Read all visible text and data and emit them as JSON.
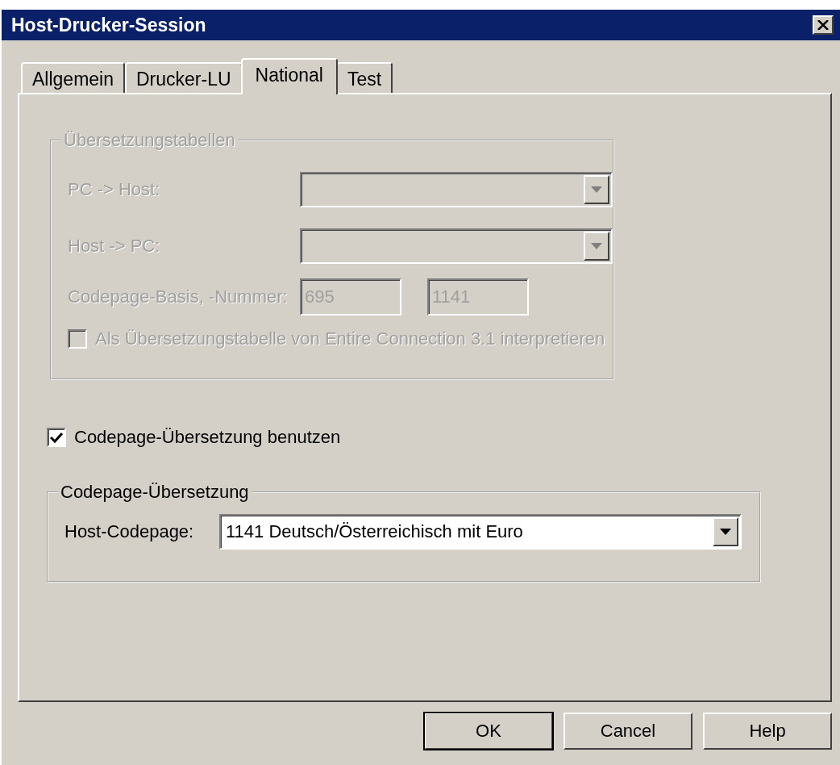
{
  "window": {
    "title": "Host-Drucker-Session"
  },
  "tabs": [
    {
      "label": "Allgemein",
      "selected": false
    },
    {
      "label": "Drucker-LU",
      "selected": false
    },
    {
      "label": "National",
      "selected": true
    },
    {
      "label": "Test",
      "selected": false
    }
  ],
  "translation_tables": {
    "title": "Übersetzungstabellen",
    "disabled": true,
    "pc_to_host": {
      "label": "PC -> Host:"
    },
    "host_to_pc": {
      "label": "Host -> PC:"
    },
    "codepage": {
      "label": "Codepage-Basis, -Nummer:",
      "base": "695",
      "number": "1141"
    },
    "checkbox": {
      "label": "Als Übersetzungstabelle von Entire Connection 3.1 interpretieren",
      "checked": false
    }
  },
  "use_codepage": {
    "label": "Codepage-Übersetzung benutzen",
    "checked": true
  },
  "codepage_translation": {
    "title": "Codepage-Übersetzung",
    "host_codepage": {
      "label": "Host-Codepage:",
      "value": "1141 Deutsch/Österreichisch mit Euro"
    }
  },
  "buttons": [
    {
      "label": "OK",
      "default": true
    },
    {
      "label": "Cancel",
      "default": false
    },
    {
      "label": "Help",
      "default": false
    }
  ]
}
